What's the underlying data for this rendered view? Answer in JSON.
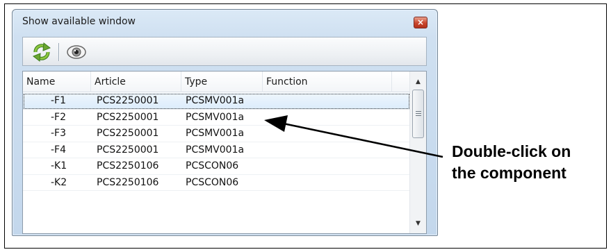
{
  "window": {
    "title": "Show available window",
    "close_label": "×"
  },
  "toolbar": {
    "buttons": [
      {
        "icon": "refresh-icon"
      },
      {
        "icon": "eye-icon"
      }
    ]
  },
  "table": {
    "columns": [
      "Name",
      "Article",
      "Type",
      "Function"
    ],
    "rows": [
      {
        "name": "-F1",
        "article": "PCS2250001",
        "type": "PCSMV001a",
        "function": "",
        "selected": true
      },
      {
        "name": "-F2",
        "article": "PCS2250001",
        "type": "PCSMV001a",
        "function": ""
      },
      {
        "name": "-F3",
        "article": "PCS2250001",
        "type": "PCSMV001a",
        "function": ""
      },
      {
        "name": "-F4",
        "article": "PCS2250001",
        "type": "PCSMV001a",
        "function": ""
      },
      {
        "name": "-K1",
        "article": "PCS2250106",
        "type": "PCSCON06",
        "function": ""
      },
      {
        "name": "-K2",
        "article": "PCS2250106",
        "type": "PCSCON06",
        "function": ""
      }
    ]
  },
  "scrollbar": {
    "up_arrow": "▲",
    "down_arrow": "▼"
  },
  "annotation": {
    "line1": "Double-click on",
    "line2": "the component"
  }
}
